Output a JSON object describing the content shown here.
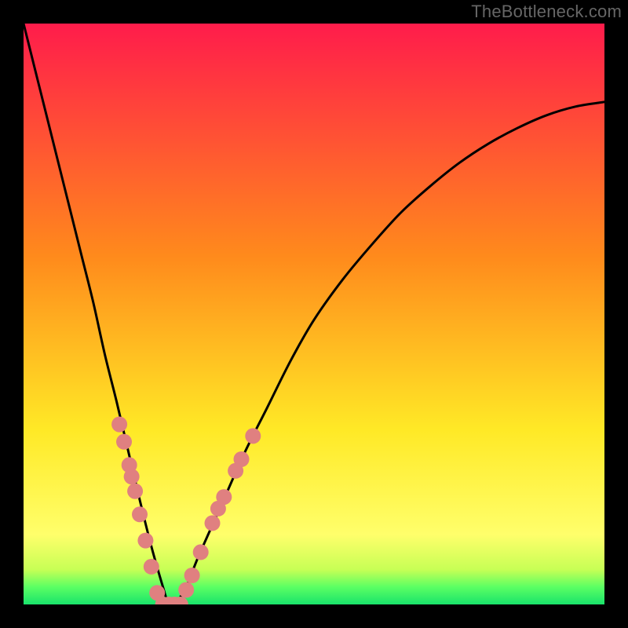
{
  "watermark": "TheBottleneck.com",
  "chart_data": {
    "type": "line",
    "title": "",
    "xlabel": "",
    "ylabel": "",
    "xlim": [
      0,
      100
    ],
    "ylim": [
      0,
      100
    ],
    "x": [
      0,
      2,
      4,
      6,
      8,
      10,
      12,
      14,
      16,
      18,
      20,
      22,
      24,
      25,
      26,
      28,
      30,
      34,
      38,
      42,
      46,
      50,
      55,
      60,
      65,
      70,
      75,
      80,
      85,
      90,
      95,
      100
    ],
    "values": [
      100,
      92,
      84,
      76,
      68,
      60,
      52,
      43,
      35,
      26.5,
      18,
      10,
      3,
      0,
      0,
      3,
      8,
      17,
      26,
      34,
      42,
      49,
      56,
      62,
      67.5,
      72,
      76,
      79.3,
      82,
      84.2,
      85.7,
      86.5
    ],
    "markers": [
      {
        "x": 16.5,
        "y": 31
      },
      {
        "x": 17.3,
        "y": 28
      },
      {
        "x": 18.2,
        "y": 24
      },
      {
        "x": 18.6,
        "y": 22
      },
      {
        "x": 19.2,
        "y": 19.5
      },
      {
        "x": 20.0,
        "y": 15.5
      },
      {
        "x": 21.0,
        "y": 11
      },
      {
        "x": 22.0,
        "y": 6.5
      },
      {
        "x": 23.0,
        "y": 2
      },
      {
        "x": 24.0,
        "y": 0
      },
      {
        "x": 25.0,
        "y": 0
      },
      {
        "x": 26.0,
        "y": 0
      },
      {
        "x": 27.0,
        "y": 0
      },
      {
        "x": 28.0,
        "y": 2.5
      },
      {
        "x": 29.0,
        "y": 5
      },
      {
        "x": 30.5,
        "y": 9
      },
      {
        "x": 32.5,
        "y": 14
      },
      {
        "x": 33.5,
        "y": 16.5
      },
      {
        "x": 34.5,
        "y": 18.5
      },
      {
        "x": 36.5,
        "y": 23
      },
      {
        "x": 37.5,
        "y": 25
      },
      {
        "x": 39.5,
        "y": 29
      }
    ],
    "gradient_stops": [
      {
        "offset": 0.0,
        "color": "#ff1c4b"
      },
      {
        "offset": 0.4,
        "color": "#ff8a1c"
      },
      {
        "offset": 0.7,
        "color": "#ffe926"
      },
      {
        "offset": 0.88,
        "color": "#ffff6b"
      },
      {
        "offset": 0.94,
        "color": "#c7ff55"
      },
      {
        "offset": 0.97,
        "color": "#5bff63"
      },
      {
        "offset": 1.0,
        "color": "#19e36b"
      }
    ],
    "marker_color": "#e08080",
    "curve_color": "#000000",
    "curve_width": 3,
    "marker_radius": 10
  }
}
